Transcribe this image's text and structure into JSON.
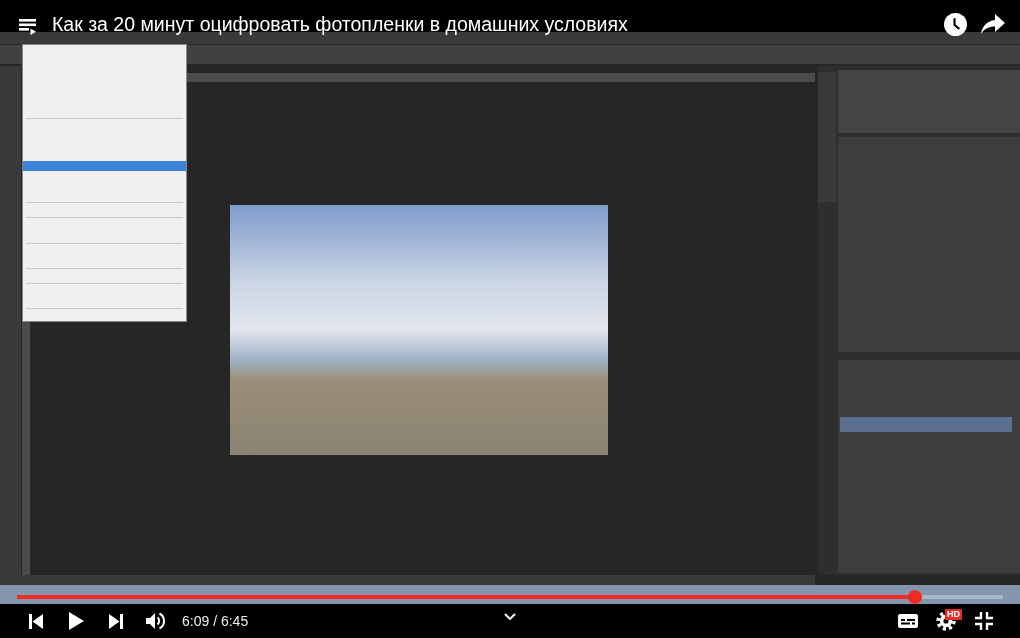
{
  "top_bar": {
    "title": "Как за 20 минут оцифровать фотопленки в домашних условиях"
  },
  "progress_bar": {
    "level": 0.911
  },
  "controls": {
    "paused": true,
    "muted": false,
    "time": "6:09 / 6:45",
    "quality_badge": "HD",
    "fullscreen": true
  }
}
